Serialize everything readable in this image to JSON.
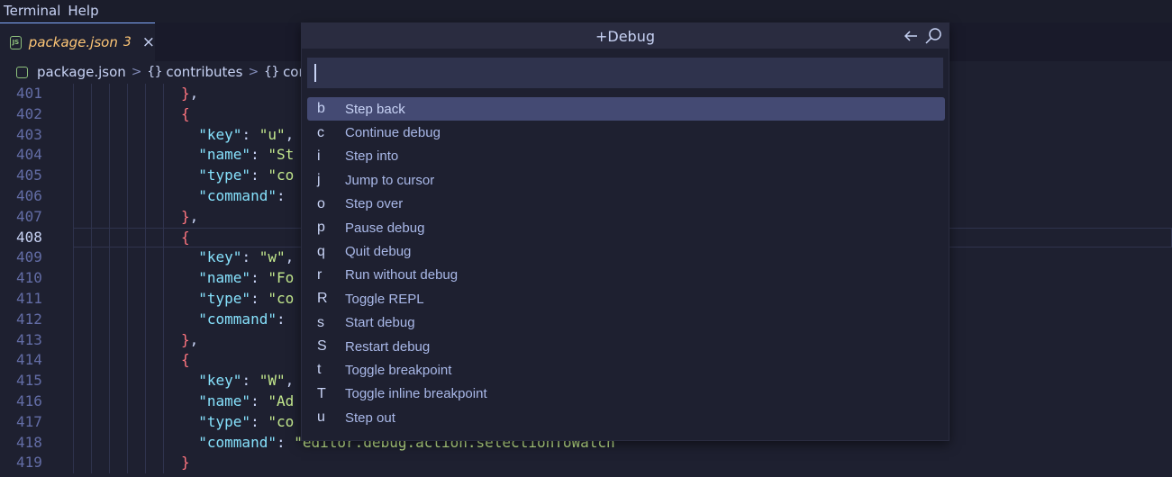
{
  "menubar": {
    "items": [
      "Terminal",
      "Help"
    ]
  },
  "tab": {
    "filename": "package.json",
    "badge": "3",
    "close_glyph": "×",
    "file_icon_text": "JS"
  },
  "breadcrumb": {
    "file": "package.json",
    "segment1": "contributes",
    "segment2": "cont",
    "brace": "{}",
    "separator": ">"
  },
  "editor": {
    "active_line": 408,
    "lines": [
      {
        "n": "401",
        "code": [
          {
            "t": "brace",
            "v": "}"
          },
          {
            "t": "punc",
            "v": ","
          }
        ]
      },
      {
        "n": "402",
        "code": [
          {
            "t": "brace",
            "v": "{"
          }
        ]
      },
      {
        "n": "403",
        "code": [
          {
            "t": "punc",
            "v": "  "
          },
          {
            "t": "key",
            "v": "\"key\""
          },
          {
            "t": "punc",
            "v": ": "
          },
          {
            "t": "str",
            "v": "\"u\""
          },
          {
            "t": "punc",
            "v": ","
          }
        ]
      },
      {
        "n": "404",
        "code": [
          {
            "t": "punc",
            "v": "  "
          },
          {
            "t": "key",
            "v": "\"name\""
          },
          {
            "t": "punc",
            "v": ": "
          },
          {
            "t": "str",
            "v": "\"St"
          }
        ]
      },
      {
        "n": "405",
        "code": [
          {
            "t": "punc",
            "v": "  "
          },
          {
            "t": "key",
            "v": "\"type\""
          },
          {
            "t": "punc",
            "v": ": "
          },
          {
            "t": "str",
            "v": "\"co"
          }
        ]
      },
      {
        "n": "406",
        "code": [
          {
            "t": "punc",
            "v": "  "
          },
          {
            "t": "key",
            "v": "\"command\""
          },
          {
            "t": "punc",
            "v": ":"
          }
        ]
      },
      {
        "n": "407",
        "code": [
          {
            "t": "brace",
            "v": "}"
          },
          {
            "t": "punc",
            "v": ","
          }
        ]
      },
      {
        "n": "408",
        "code": [
          {
            "t": "brace",
            "v": "{"
          }
        ]
      },
      {
        "n": "409",
        "code": [
          {
            "t": "punc",
            "v": "  "
          },
          {
            "t": "key",
            "v": "\"key\""
          },
          {
            "t": "punc",
            "v": ": "
          },
          {
            "t": "str",
            "v": "\"w\""
          },
          {
            "t": "punc",
            "v": ","
          }
        ]
      },
      {
        "n": "410",
        "code": [
          {
            "t": "punc",
            "v": "  "
          },
          {
            "t": "key",
            "v": "\"name\""
          },
          {
            "t": "punc",
            "v": ": "
          },
          {
            "t": "str",
            "v": "\"Fo"
          }
        ]
      },
      {
        "n": "411",
        "code": [
          {
            "t": "punc",
            "v": "  "
          },
          {
            "t": "key",
            "v": "\"type\""
          },
          {
            "t": "punc",
            "v": ": "
          },
          {
            "t": "str",
            "v": "\"co"
          }
        ]
      },
      {
        "n": "412",
        "code": [
          {
            "t": "punc",
            "v": "  "
          },
          {
            "t": "key",
            "v": "\"command\""
          },
          {
            "t": "punc",
            "v": ":"
          }
        ]
      },
      {
        "n": "413",
        "code": [
          {
            "t": "brace",
            "v": "}"
          },
          {
            "t": "punc",
            "v": ","
          }
        ]
      },
      {
        "n": "414",
        "code": [
          {
            "t": "brace",
            "v": "{"
          }
        ]
      },
      {
        "n": "415",
        "code": [
          {
            "t": "punc",
            "v": "  "
          },
          {
            "t": "key",
            "v": "\"key\""
          },
          {
            "t": "punc",
            "v": ": "
          },
          {
            "t": "str",
            "v": "\"W\""
          },
          {
            "t": "punc",
            "v": ","
          }
        ]
      },
      {
        "n": "416",
        "code": [
          {
            "t": "punc",
            "v": "  "
          },
          {
            "t": "key",
            "v": "\"name\""
          },
          {
            "t": "punc",
            "v": ": "
          },
          {
            "t": "str",
            "v": "\"Ad"
          }
        ]
      },
      {
        "n": "417",
        "code": [
          {
            "t": "punc",
            "v": "  "
          },
          {
            "t": "key",
            "v": "\"type\""
          },
          {
            "t": "punc",
            "v": ": "
          },
          {
            "t": "str",
            "v": "\"co"
          }
        ]
      },
      {
        "n": "418",
        "code": [
          {
            "t": "punc",
            "v": "  "
          },
          {
            "t": "key",
            "v": "\"command\""
          },
          {
            "t": "punc",
            "v": ": "
          },
          {
            "t": "str",
            "v": "\"editor.debug.action.selectionToWatch\""
          }
        ]
      },
      {
        "n": "419",
        "code": [
          {
            "t": "brace",
            "v": "}"
          }
        ]
      }
    ]
  },
  "quickpick": {
    "title": "+Debug",
    "input_value": "",
    "back_icon": "arrow-left-icon",
    "search_icon": "search-icon",
    "items": [
      {
        "key": "b",
        "label": "Step back",
        "selected": true
      },
      {
        "key": "c",
        "label": "Continue debug"
      },
      {
        "key": "i",
        "label": "Step into"
      },
      {
        "key": "j",
        "label": "Jump to cursor"
      },
      {
        "key": "o",
        "label": "Step over"
      },
      {
        "key": "p",
        "label": "Pause debug"
      },
      {
        "key": "q",
        "label": "Quit debug"
      },
      {
        "key": "r",
        "label": "Run without debug"
      },
      {
        "key": "R",
        "label": "Toggle REPL"
      },
      {
        "key": "s",
        "label": "Start debug"
      },
      {
        "key": "S",
        "label": "Restart debug"
      },
      {
        "key": "t",
        "label": "Toggle breakpoint"
      },
      {
        "key": "T",
        "label": "Toggle inline breakpoint"
      },
      {
        "key": "u",
        "label": "Step out"
      }
    ]
  },
  "colors": {
    "background": "#1e2030",
    "accent": "#82aaff",
    "selection": "#444a73",
    "tab_name": "#ffc777"
  }
}
